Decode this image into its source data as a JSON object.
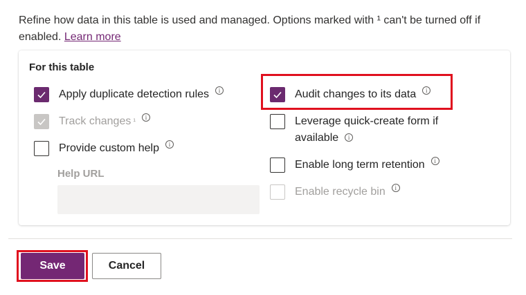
{
  "intro": {
    "text": "Refine how data in this table is used and managed. Options marked with ¹ can't be turned off if enabled.",
    "learn_more": "Learn more"
  },
  "section": {
    "title": "For this table",
    "left_options": [
      {
        "label": "Apply duplicate detection rules",
        "checked": true,
        "disabled": false
      },
      {
        "label": "Track changes",
        "superscript": "¹",
        "checked": true,
        "disabled": true
      },
      {
        "label": "Provide custom help",
        "checked": false,
        "disabled": false
      }
    ],
    "help_url_label": "Help URL",
    "help_url_value": "",
    "right_options": [
      {
        "label": "Audit changes to its data",
        "checked": true,
        "disabled": false
      },
      {
        "label": "Leverage quick-create form if available",
        "checked": false,
        "disabled": false
      },
      {
        "label": "Enable long term retention",
        "checked": false,
        "disabled": false
      },
      {
        "label": "Enable recycle bin",
        "checked": false,
        "disabled": true
      }
    ]
  },
  "footer": {
    "save_label": "Save",
    "cancel_label": "Cancel"
  },
  "colors": {
    "accent": "#742774",
    "highlight": "#e0101e"
  }
}
